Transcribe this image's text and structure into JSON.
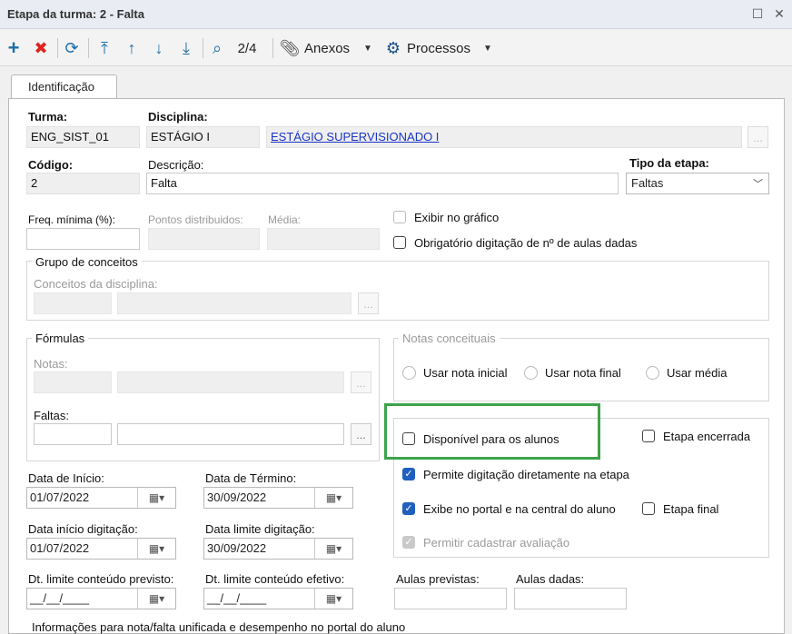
{
  "window": {
    "title": "Etapa da turma: 2 - Falta"
  },
  "toolbar": {
    "record_position": "2/4",
    "attachments": "Anexos",
    "processes": "Processos"
  },
  "tab": {
    "label": "Identificação"
  },
  "form": {
    "turma": {
      "label": "Turma:",
      "value": "ENG_SIST_01"
    },
    "disciplina": {
      "label": "Disciplina:",
      "code": "ESTÁGIO I",
      "name": "ESTÁGIO SUPERVISIONADO I"
    },
    "codigo": {
      "label": "Código:",
      "value": "2"
    },
    "descricao": {
      "label": "Descrição:",
      "value": "Falta"
    },
    "tipo_etapa": {
      "label": "Tipo da etapa:",
      "value": "Faltas"
    },
    "freq_minima": {
      "label": "Freq. mínima (%):",
      "value": ""
    },
    "pontos_distribuidos": {
      "label": "Pontos distribuidos:"
    },
    "media": {
      "label": "Média:"
    },
    "exibir_grafico": "Exibir no gráfico",
    "obrigatorio_aulas": "Obrigatório digitação de nº de aulas dadas",
    "grupo_conceitos": {
      "title": "Grupo de conceitos",
      "conceitos_label": "Conceitos da disciplina:"
    },
    "formulas": {
      "title": "Fórmulas",
      "notas_label": "Notas:",
      "faltas_label": "Faltas:"
    },
    "notas_conceituais": {
      "title": "Notas conceituais",
      "options": [
        "Usar nota inicial",
        "Usar nota final",
        "Usar média"
      ]
    },
    "options": {
      "disponivel_alunos": "Disponível para os alunos",
      "etapa_encerrada": "Etapa encerrada",
      "permite_digitacao": "Permite digitação diretamente na etapa",
      "exibe_portal": "Exibe no portal e na central do aluno",
      "etapa_final": "Etapa final",
      "permitir_avaliacao": "Permitir cadastrar avaliação"
    },
    "data_inicio": {
      "label": "Data de Início:",
      "value": "01/07/2022"
    },
    "data_termino": {
      "label": "Data de Término:",
      "value": "30/09/2022"
    },
    "data_inicio_digitacao": {
      "label": "Data início digitação:",
      "value": "01/07/2022"
    },
    "data_limite_digitacao": {
      "label": "Data limite digitação:",
      "value": "30/09/2022"
    },
    "dt_limite_previsto": {
      "label": "Dt. limite conteúdo previsto:",
      "value": "__/__/____"
    },
    "dt_limite_efetivo": {
      "label": "Dt. limite conteúdo efetivo:",
      "value": "__/__/____"
    },
    "aulas_previstas": {
      "label": "Aulas previstas:",
      "value": ""
    },
    "aulas_dadas": {
      "label": "Aulas dadas:",
      "value": ""
    },
    "footer_text": "Informações para nota/falta unificada e desempenho no portal do aluno"
  },
  "colors": {
    "accent": "#1f5fbf",
    "highlight": "#3ca34a",
    "link": "#1a33c8"
  }
}
